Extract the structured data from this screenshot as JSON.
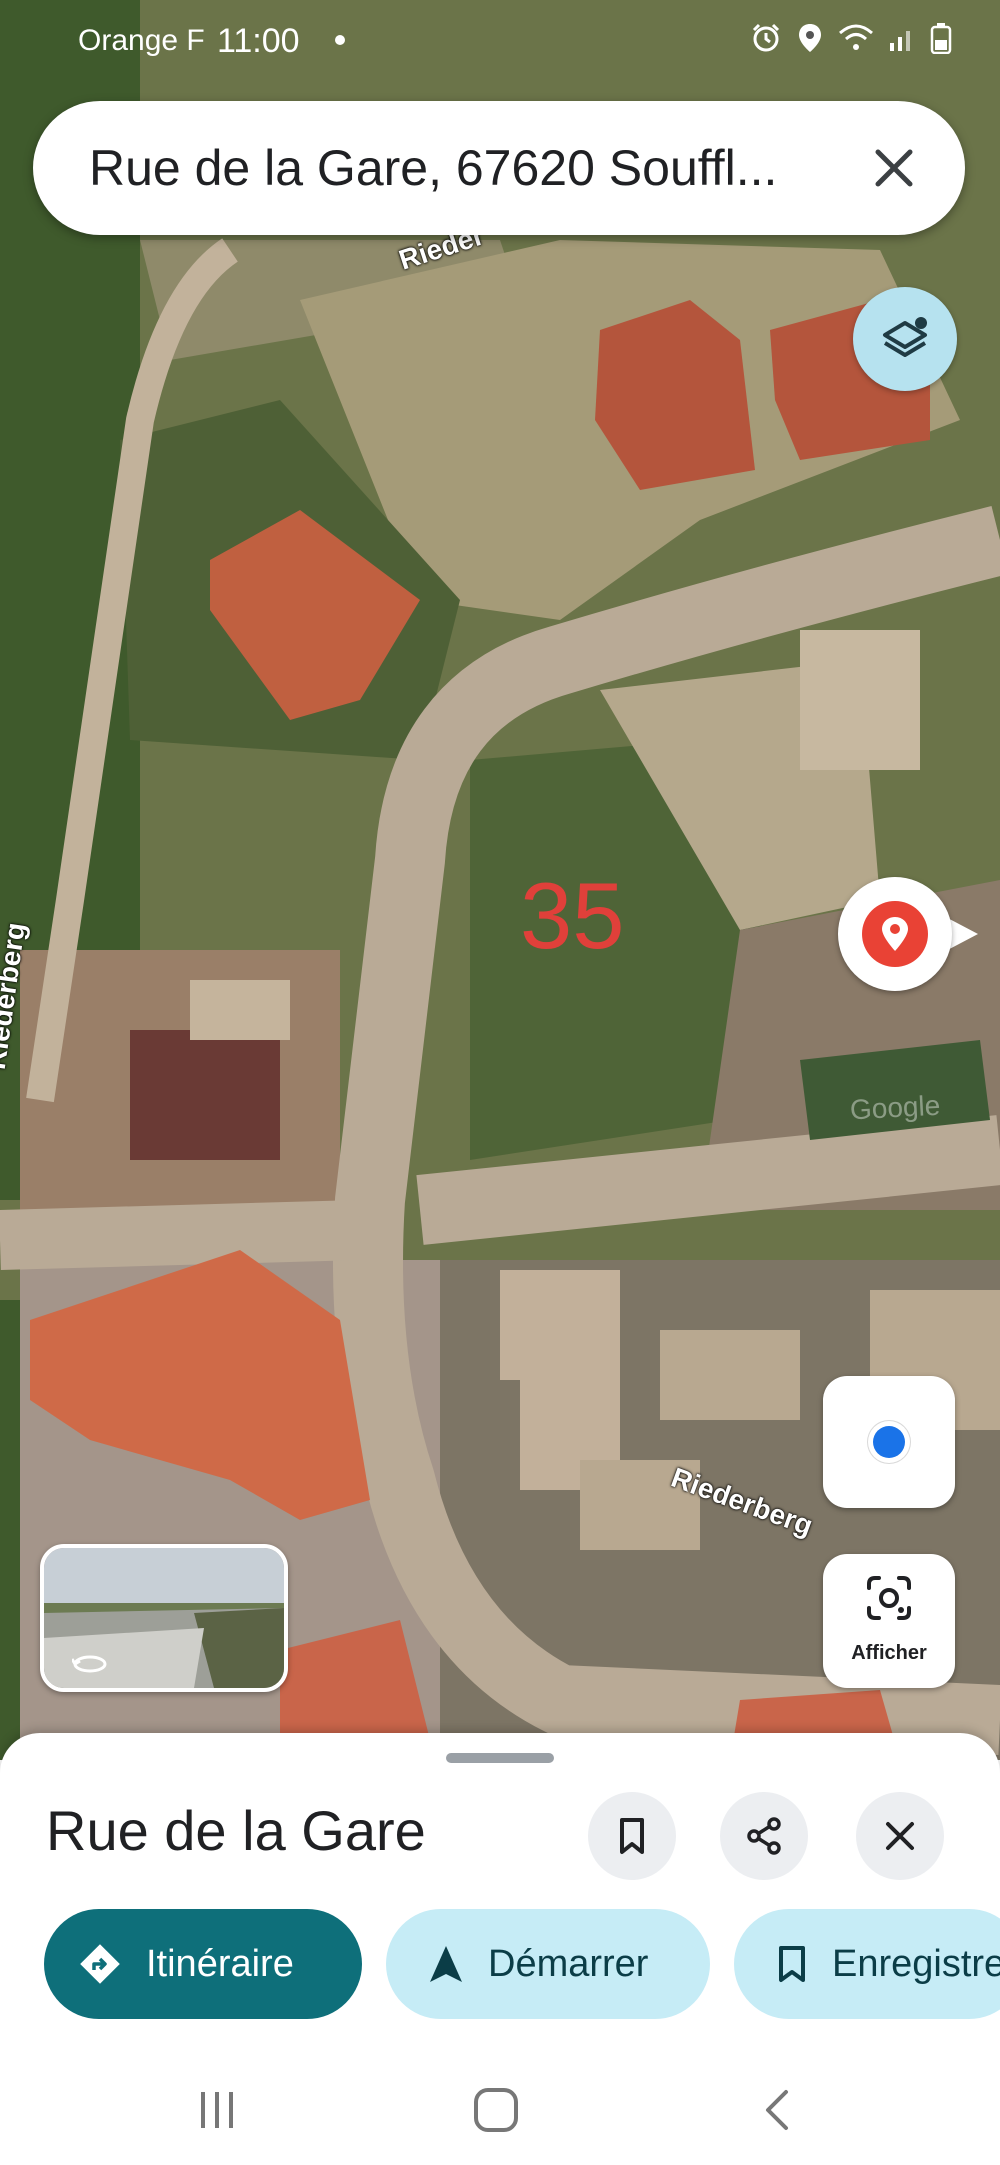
{
  "status_bar": {
    "carrier": "Orange F",
    "time": "11:00",
    "icons": [
      "alarm-icon",
      "location-icon",
      "wifi-icon",
      "signal-icon",
      "battery-icon"
    ]
  },
  "search": {
    "query": "Rue de la Gare, 67620 Souffl...",
    "close_icon": "close-icon"
  },
  "map": {
    "street_labels": [
      "Rieder",
      "Riederberg",
      "Riederberg"
    ],
    "overlay_number": "35",
    "overlay_number_color": "#e0403a",
    "watermark": "Google",
    "pin_color": "#e94235"
  },
  "controls": {
    "layers_icon": "layers-icon",
    "my_location_icon": "my-location-icon",
    "lens_label": "Afficher"
  },
  "place_sheet": {
    "title": "Rue de la Gare",
    "actions": [
      "bookmark-icon",
      "share-icon",
      "close-icon"
    ],
    "chips": {
      "directions": "Itinéraire",
      "start": "Démarrer",
      "save": "Enregistrer"
    },
    "accent_color": "#0e6f7a"
  },
  "navbar": {
    "buttons": [
      "recent-apps",
      "home",
      "back"
    ]
  }
}
